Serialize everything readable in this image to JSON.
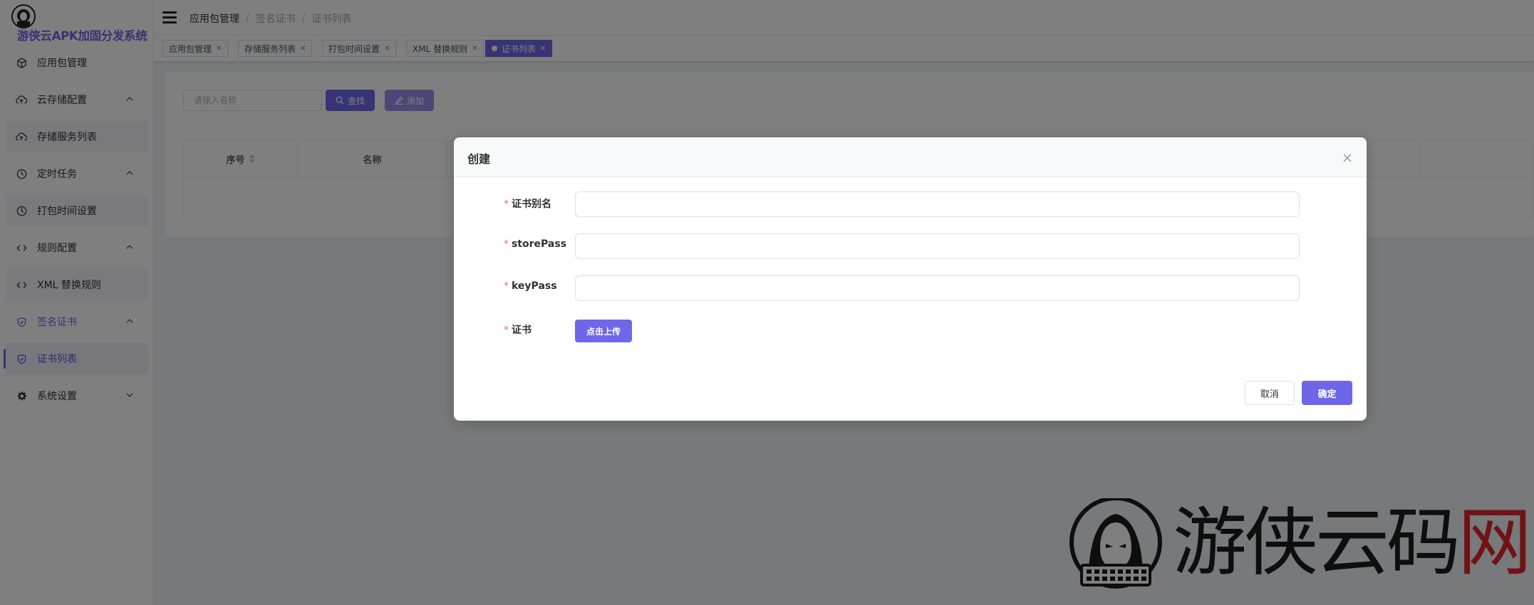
{
  "brand": {
    "title": "游侠云APK加固分发系统"
  },
  "sidebar": {
    "items": [
      {
        "label": "应用包管理",
        "icon": "package-icon",
        "type": "item"
      },
      {
        "label": "云存储配置",
        "icon": "cloud-upload-icon",
        "type": "group",
        "expanded": true
      },
      {
        "label": "存储服务列表",
        "icon": "cloud-upload-icon",
        "type": "sub"
      },
      {
        "label": "定时任务",
        "icon": "clock-icon",
        "type": "group",
        "expanded": true
      },
      {
        "label": "打包时间设置",
        "icon": "clock-icon",
        "type": "sub"
      },
      {
        "label": "规则配置",
        "icon": "code-icon",
        "type": "group",
        "expanded": true
      },
      {
        "label": "XML 替换规则",
        "icon": "code-icon",
        "type": "sub"
      },
      {
        "label": "签名证书",
        "icon": "shield-icon",
        "type": "group",
        "expanded": true,
        "active": true
      },
      {
        "label": "证书列表",
        "icon": "shield-icon",
        "type": "sub",
        "active": true
      },
      {
        "label": "系统设置",
        "icon": "gear-icon",
        "type": "group",
        "expanded": false
      }
    ]
  },
  "header": {
    "breadcrumb": [
      "应用包管理",
      "签名证书",
      "证书列表"
    ]
  },
  "tabs": [
    {
      "label": "应用包管理"
    },
    {
      "label": "存储服务列表"
    },
    {
      "label": "打包时间设置"
    },
    {
      "label": "XML 替换规则"
    },
    {
      "label": "证书列表",
      "active": true
    }
  ],
  "toolbar": {
    "search_placeholder": "请输入名称",
    "search_label": "查找",
    "add_label": "添加"
  },
  "table": {
    "columns": [
      "序号",
      "名称"
    ]
  },
  "dialog": {
    "title": "创建",
    "fields": [
      {
        "label": "证书别名",
        "required": true,
        "value": ""
      },
      {
        "label": "storePass",
        "required": true,
        "value": ""
      },
      {
        "label": "keyPass",
        "required": true,
        "value": ""
      },
      {
        "label": "证书",
        "required": true
      }
    ],
    "upload_label": "点击上传",
    "cancel_label": "取消",
    "confirm_label": "确定"
  },
  "watermark": {
    "text_main": "游侠云码",
    "text_accent": "网"
  },
  "colors": {
    "accent": "#6e66e8",
    "required": "#f56c6c",
    "overlay": "rgba(0,0,0,0.5)"
  }
}
